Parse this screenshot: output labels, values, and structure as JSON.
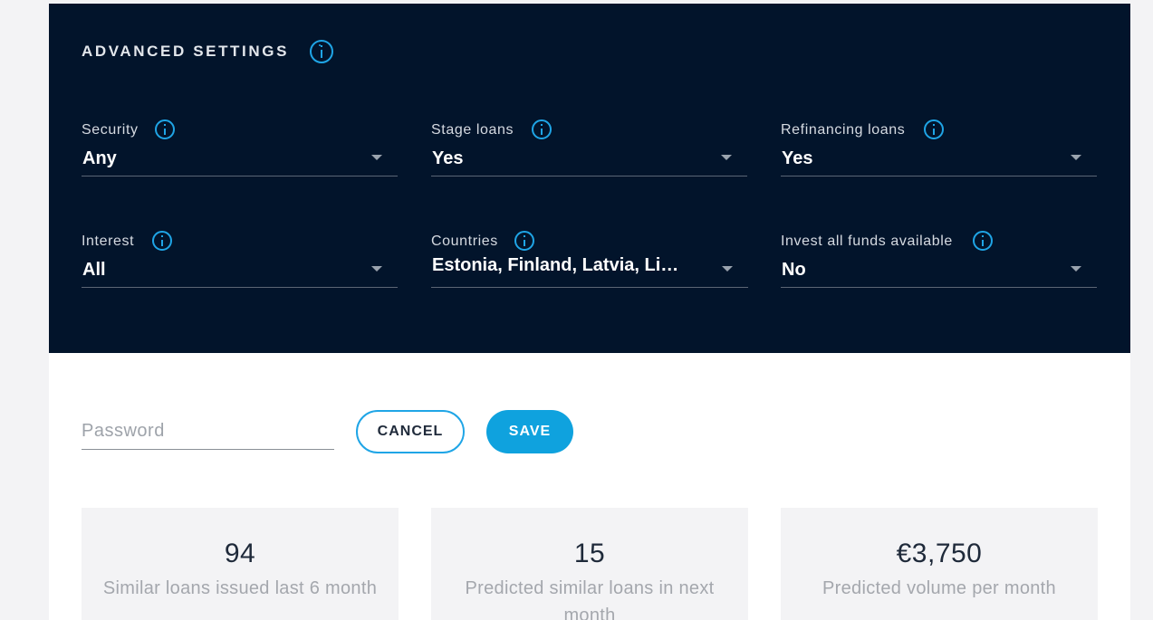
{
  "advanced_settings": {
    "title": "ADVANCED SETTINGS",
    "fields": [
      {
        "label": "Security",
        "value": "Any"
      },
      {
        "label": "Stage loans",
        "value": "Yes"
      },
      {
        "label": "Refinancing loans",
        "value": "Yes"
      },
      {
        "label": "Interest",
        "value": "All"
      },
      {
        "label": "Countries",
        "value": "Estonia, Finland, Latvia, Lithuania"
      },
      {
        "label": "Invest all funds available",
        "value": "No"
      }
    ]
  },
  "form": {
    "password_placeholder": "Password",
    "cancel_label": "CANCEL",
    "save_label": "SAVE"
  },
  "stats": [
    {
      "value": "94",
      "label": "Similar loans issued last 6 month"
    },
    {
      "value": "15",
      "label": "Predicted similar loans in next month"
    },
    {
      "value": "€3,750",
      "label": "Predicted volume per month"
    }
  ],
  "colors": {
    "dark_background": "#02142b",
    "accent": "#0fa2de",
    "info_icon": "#1fa5e6"
  },
  "icons": {
    "info": "info-circle-icon",
    "dropdown": "caret-down-icon"
  }
}
